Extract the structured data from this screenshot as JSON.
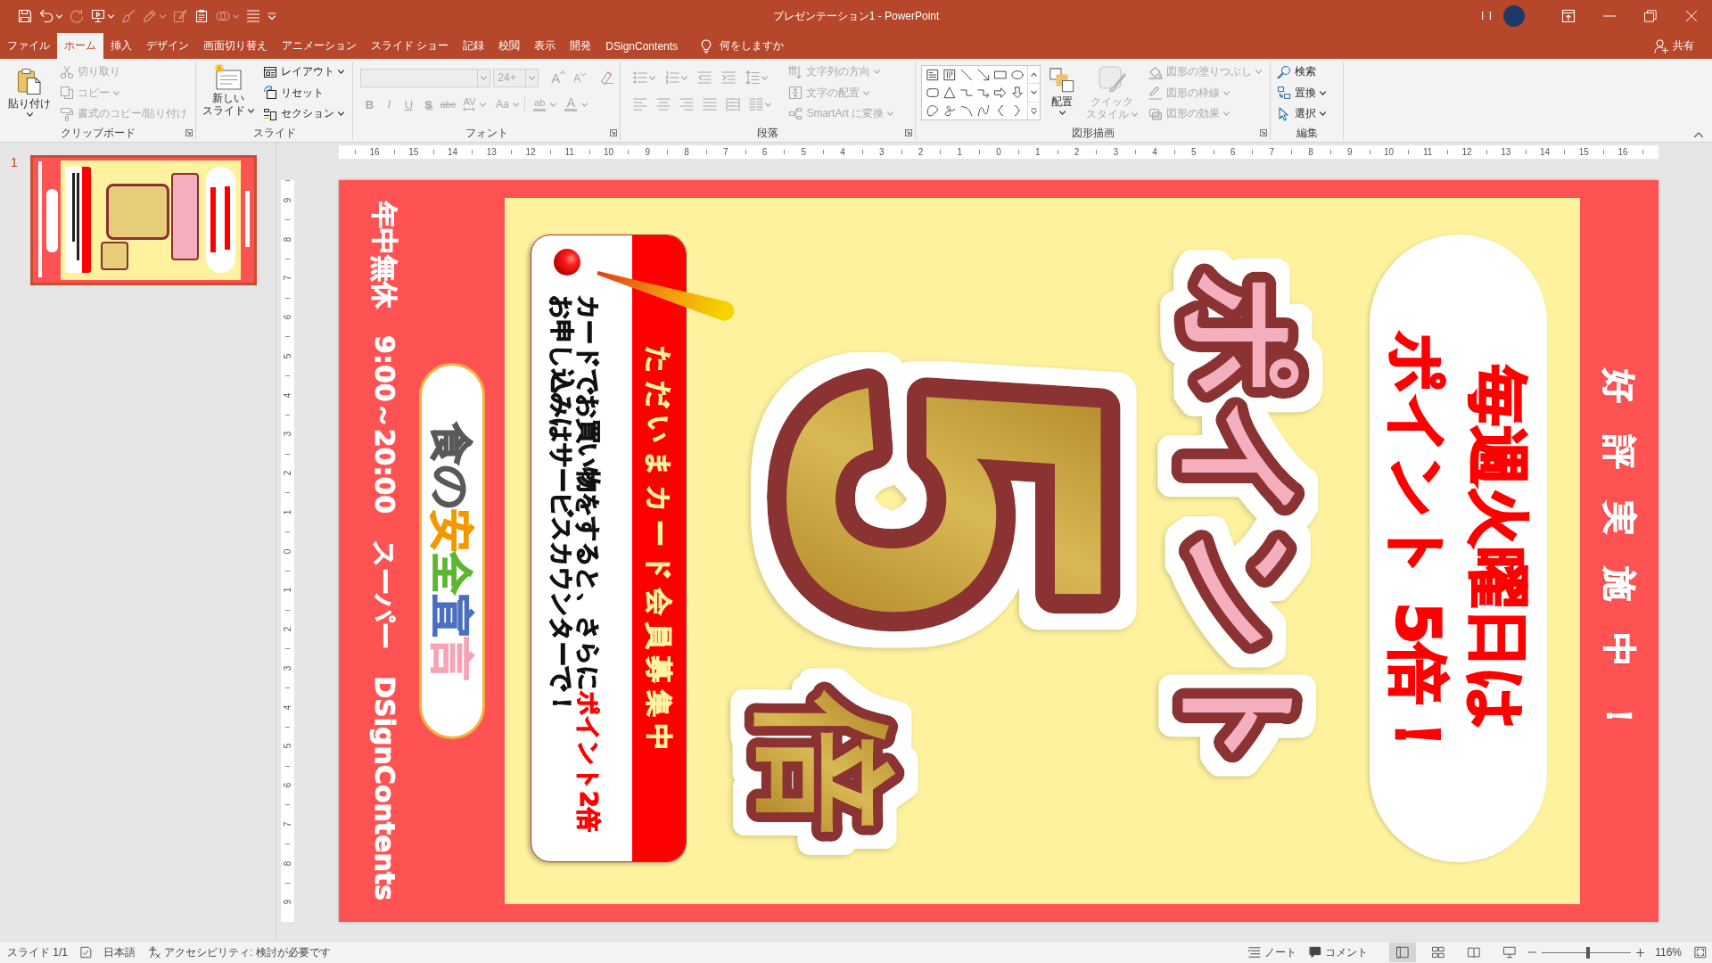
{
  "window": {
    "title": "プレゼンテーション1 - PowerPoint",
    "account": "I I"
  },
  "quick_access": [
    {
      "disabled": false
    },
    {
      "disabled": false
    },
    {
      "disabled": true
    },
    {
      "disabled": false
    },
    {
      "disabled": true
    },
    {
      "disabled": true
    },
    {
      "disabled": true
    },
    {
      "disabled": false
    },
    {
      "disabled": true
    },
    {
      "disabled": false
    }
  ],
  "tabs": [
    {
      "label": "ファイル",
      "selected": false
    },
    {
      "label": "ホーム",
      "selected": true
    },
    {
      "label": "挿入",
      "selected": false
    },
    {
      "label": "デザイン",
      "selected": false
    },
    {
      "label": "画面切り替え",
      "selected": false
    },
    {
      "label": "アニメーション",
      "selected": false
    },
    {
      "label": "スライド ショー",
      "selected": false
    },
    {
      "label": "記録",
      "selected": false
    },
    {
      "label": "校閲",
      "selected": false
    },
    {
      "label": "表示",
      "selected": false
    },
    {
      "label": "開発",
      "selected": false
    },
    {
      "label": "DSignContents",
      "selected": false
    }
  ],
  "tell_me": "何をしますか",
  "share": "共有",
  "ribbon": {
    "clipboard": {
      "label": "クリップボード",
      "paste": "貼り付け",
      "items": [
        {
          "label": "切り取り",
          "disabled": true
        },
        {
          "label": "コピー",
          "disabled": true
        },
        {
          "label": "書式のコピー/貼り付け",
          "disabled": true
        }
      ]
    },
    "slides": {
      "label": "スライド",
      "new_slide": [
        "新しい",
        "スライド"
      ],
      "items": [
        {
          "label": "レイアウト",
          "disabled": false
        },
        {
          "label": "リセット",
          "disabled": false
        },
        {
          "label": "セクション",
          "disabled": false
        }
      ]
    },
    "font": {
      "label": "フォント",
      "disabled": true,
      "size": "24+",
      "grow": "A",
      "shrink": "A",
      "styles": [
        "B",
        "I",
        "U",
        "S",
        "abc",
        "AV",
        "Aa"
      ],
      "highlighter": "ab",
      "font_color": "A"
    },
    "paragraph": {
      "label": "段落",
      "disabled": true,
      "items": [
        "文字列の方向",
        "文字の配置",
        "SmartArt に変換"
      ]
    },
    "drawing": {
      "label": "図形描画",
      "arrange": "配置",
      "quick_styles": {
        "label": [
          "クイック",
          "スタイル"
        ],
        "disabled": true
      },
      "items": [
        {
          "label": "図形の塗りつぶし",
          "disabled": true
        },
        {
          "label": "図形の枠線",
          "disabled": true
        },
        {
          "label": "図形の効果",
          "disabled": true
        }
      ]
    },
    "editing": {
      "label": "編集",
      "items": [
        {
          "label": "検索",
          "disabled": false
        },
        {
          "label": "置換",
          "disabled": false
        },
        {
          "label": "選択",
          "disabled": false
        }
      ]
    }
  },
  "slides_panel": [
    {
      "number": "1",
      "selected": true
    }
  ],
  "rulers": {
    "horizontal": [
      "16",
      "15",
      "14",
      "13",
      "12",
      "11",
      "10",
      "9",
      "8",
      "7",
      "6",
      "5",
      "4",
      "3",
      "2",
      "1",
      "0",
      "1",
      "2",
      "3",
      "4",
      "5",
      "6",
      "7",
      "8",
      "9",
      "10",
      "11",
      "12",
      "13",
      "14",
      "15",
      "16"
    ],
    "vertical": [
      "9",
      "8",
      "7",
      "6",
      "5",
      "4",
      "3",
      "2",
      "1",
      "0",
      "1",
      "2",
      "3",
      "4",
      "5",
      "6",
      "7",
      "8",
      "9"
    ]
  },
  "slide": {
    "banner": "好評実施中！",
    "callout": [
      "毎週火曜日は",
      "ポイント 5倍！"
    ],
    "headline": "ポイント",
    "multiplier": {
      "number": "5",
      "unit": "倍"
    },
    "card": {
      "title": "ただいまカード会員募集中",
      "lines": [
        [
          {
            "text": "カードでお買い物をすると、さらに",
            "highlight": false
          },
          {
            "text": "ポイント2倍",
            "highlight": true
          }
        ],
        [
          {
            "text": "お申し込みはサービスカウンターで！",
            "highlight": false
          }
        ]
      ]
    },
    "motto": [
      {
        "text": "食の",
        "color": "#595959"
      },
      {
        "text": "安",
        "color": "#f39800"
      },
      {
        "text": "全",
        "color": "#5db530"
      },
      {
        "text": "宣",
        "color": "#4a6fbe"
      },
      {
        "text": "言",
        "color": "#f5a3b5"
      }
    ],
    "footer": "年中無休　9:00～20:00　スーパー　DSignContents"
  },
  "status_bar": {
    "slide": "スライド 1/1",
    "language": "日本語",
    "accessibility": "アクセシビリティ: 検討が必要です",
    "notes": "ノート",
    "comments": "コメント",
    "views": [
      {
        "selected": true
      },
      {
        "selected": false
      },
      {
        "selected": false
      },
      {
        "selected": false
      }
    ],
    "zoom": {
      "level": 0.52,
      "value": "116%"
    }
  }
}
